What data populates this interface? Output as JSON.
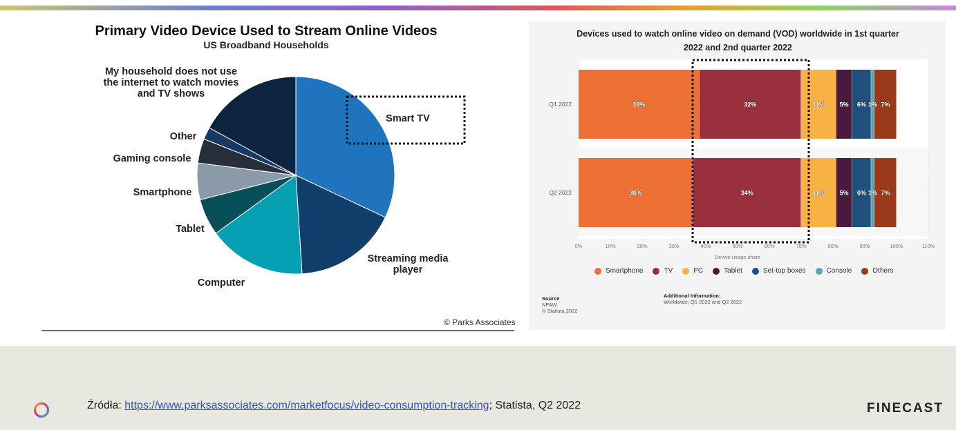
{
  "left_chart": {
    "title": "Primary Video Device Used to Stream Online Videos",
    "subtitle": "US Broadband Households",
    "copyright": "© Parks Associates"
  },
  "right_chart": {
    "title_line1": "Devices used to watch online video on demand (VOD) worldwide in 1st quarter",
    "title_line2": "2022 and 2nd quarter 2022",
    "source_label": "Source",
    "source_lines": [
      "NPAW",
      "© Statista 2022"
    ],
    "additional_label": "Additional Information:",
    "additional_text": "Worldwide; Q1 2022 and Q2 2022"
  },
  "chart_data": [
    {
      "type": "pie",
      "title": "Primary Video Device Used to Stream Online Videos",
      "subtitle": "US Broadband Households",
      "slices": [
        {
          "label": "Smart TV",
          "value": 32,
          "color": "#1f74bd"
        },
        {
          "label": "Streaming media player",
          "value": 17,
          "color": "#113e6b"
        },
        {
          "label": "Computer",
          "value": 16,
          "color": "#06a0b5"
        },
        {
          "label": "Tablet",
          "value": 6,
          "color": "#084f5a"
        },
        {
          "label": "Smartphone",
          "value": 6,
          "color": "#8a9aa6"
        },
        {
          "label": "Gaming console",
          "value": 4,
          "color": "#26303b"
        },
        {
          "label": "Other",
          "value": 2,
          "color": "#163a63"
        },
        {
          "label": "My household does not use the internet to watch movies and TV shows",
          "value": 17,
          "color": "#0d2440"
        }
      ],
      "highlight": "Smart TV"
    },
    {
      "type": "bar",
      "orientation": "horizontal",
      "stacked": true,
      "title": "Devices used to watch online video on demand (VOD) worldwide in 1st quarter 2022 and 2nd quarter 2022",
      "categories": [
        "Q1 2022",
        "Q2 2022"
      ],
      "series": [
        {
          "name": "Smartphone",
          "values": [
            38,
            36
          ],
          "color": "#ed6f34"
        },
        {
          "name": "TV",
          "values": [
            32,
            34
          ],
          "color": "#992e3c"
        },
        {
          "name": "PC",
          "values": [
            11,
            11
          ],
          "color": "#f7b145"
        },
        {
          "name": "Tablet",
          "values": [
            5,
            5
          ],
          "color": "#4a1a3c"
        },
        {
          "name": "Set-top boxes",
          "values": [
            6,
            6
          ],
          "color": "#204e7d"
        },
        {
          "name": "Console",
          "values": [
            1,
            1
          ],
          "color": "#5aa5b4"
        },
        {
          "name": "Others",
          "values": [
            7,
            7
          ],
          "color": "#9a3a1b"
        }
      ],
      "xlabel": "Device usage share",
      "xlim": [
        0,
        110
      ],
      "xticks": [
        "0%",
        "10%",
        "20%",
        "30%",
        "40%",
        "50%",
        "60%",
        "70%",
        "80%",
        "90%",
        "100%",
        "110%"
      ],
      "legend": "bottom",
      "highlight": "TV"
    }
  ],
  "footer": {
    "sources_prefix": "Źródła: ",
    "link_text": "https://www.parksassociates.com/marketfocus/video-consumption-tracking",
    "sources_suffix": "; Statista, Q2 2022",
    "brand": "FINECAST",
    "logo_icon": "ring-logo-icon"
  },
  "colors": {
    "footer_bg": "#e8e8e0",
    "panel_bg": "#f4f4f4",
    "link": "#2b57c7"
  }
}
